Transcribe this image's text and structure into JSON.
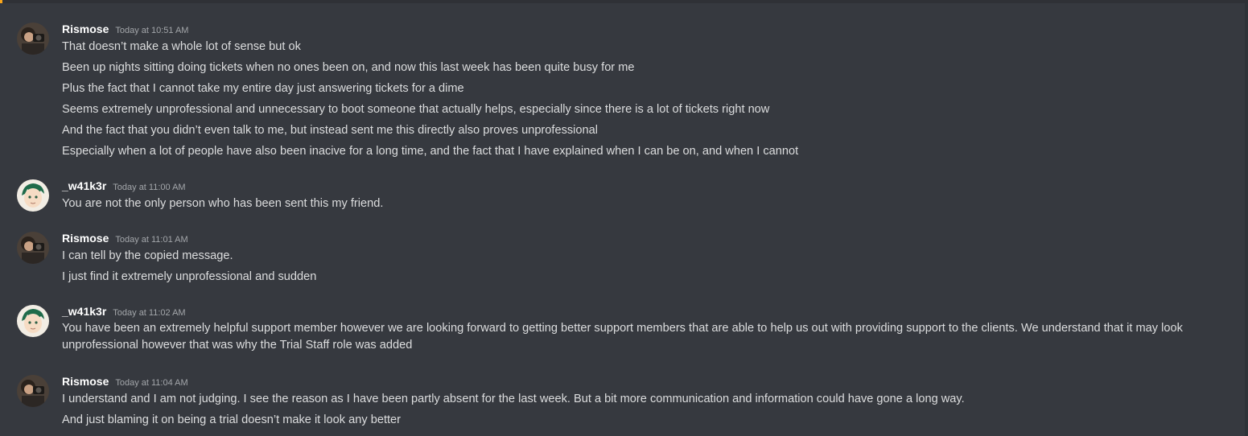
{
  "groups": [
    {
      "username": "Rismose",
      "timestamp": "Today at 10:51 AM",
      "avatar": "rismose-avatar",
      "messages": [
        "That doesn’t make a whole lot of sense but ok",
        "Been up nights sitting doing tickets when no ones been on, and now this last week has been quite busy for me",
        "Plus the fact that I cannot take my entire day just answering tickets for a dime",
        "Seems extremely unprofessional and unnecessary to boot someone that actually helps, especially since there is a lot of tickets right now",
        "And the fact that you didn’t even talk to me, but instead sent me this directly also proves unprofessional",
        "Especially when a lot of people have also been inacive for a long time, and the fact that I have explained when I can be on, and when I cannot"
      ]
    },
    {
      "username": "_w41k3r",
      "timestamp": "Today at 11:00 AM",
      "avatar": "w41k3r-avatar",
      "messages": [
        "You are not the only person who has been sent this my friend."
      ]
    },
    {
      "username": "Rismose",
      "timestamp": "Today at 11:01 AM",
      "avatar": "rismose-avatar",
      "messages": [
        "I can tell by the copied message.",
        "I just find it extremely unprofessional and sudden"
      ]
    },
    {
      "username": "_w41k3r",
      "timestamp": "Today at 11:02 AM",
      "avatar": "w41k3r-avatar",
      "messages": [
        "You have been an extremely helpful support member however we are looking forward to getting better support members that are able to help us out with providing support to the clients. We understand that it may look unprofessional however that was why the Trial Staff role was added"
      ]
    },
    {
      "username": "Rismose",
      "timestamp": "Today at 11:04 AM",
      "avatar": "rismose-avatar",
      "messages": [
        "I understand and I am not judging. I see the reason as I have been partly absent for the last week. But a bit more communication and information could have gone a long way.",
        "And just blaming it on being a trial doesn’t make it look any better"
      ]
    }
  ]
}
